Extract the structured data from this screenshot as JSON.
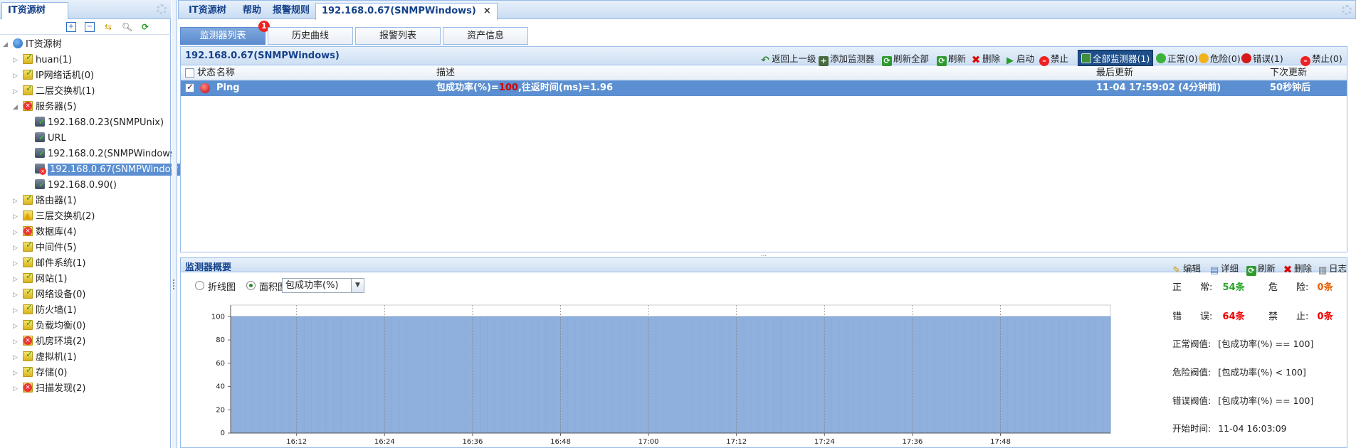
{
  "left_panel": {
    "tab_title": "IT资源树",
    "tree": {
      "root": "IT资源树",
      "items": [
        {
          "label": "huan(1)",
          "type": "folder-ok"
        },
        {
          "label": "IP网络话机(0)",
          "type": "folder-ok"
        },
        {
          "label": "二层交换机(1)",
          "type": "folder-ok"
        },
        {
          "label": "服务器(5)",
          "type": "folder-err",
          "expanded": true,
          "children": [
            {
              "label": "192.168.0.23(SNMPUnix)",
              "type": "server-ok"
            },
            {
              "label": "URL",
              "type": "server-ok"
            },
            {
              "label": "192.168.0.2(SNMPWindows",
              "type": "server-ok"
            },
            {
              "label": "192.168.0.67(SNMPWindow",
              "type": "server-err",
              "selected": true
            },
            {
              "label": "192.168.0.90()",
              "type": "server-ok"
            }
          ]
        },
        {
          "label": "路由器(1)",
          "type": "folder-ok"
        },
        {
          "label": "三层交换机(2)",
          "type": "folder-warn"
        },
        {
          "label": "数据库(4)",
          "type": "folder-err"
        },
        {
          "label": "中间件(5)",
          "type": "folder-ok"
        },
        {
          "label": "邮件系统(1)",
          "type": "folder-ok"
        },
        {
          "label": "网站(1)",
          "type": "folder-ok"
        },
        {
          "label": "网络设备(0)",
          "type": "folder-ok"
        },
        {
          "label": "防火墙(1)",
          "type": "folder-ok"
        },
        {
          "label": "负载均衡(0)",
          "type": "folder-ok"
        },
        {
          "label": "机房环境(2)",
          "type": "folder-err"
        },
        {
          "label": "虚拟机(1)",
          "type": "folder-ok"
        },
        {
          "label": "存储(0)",
          "type": "folder-ok"
        },
        {
          "label": "扫描发现(2)",
          "type": "folder-err"
        }
      ]
    }
  },
  "main_tabs": [
    {
      "label": "IT资源树"
    },
    {
      "label": "帮助"
    },
    {
      "label": "报警规则"
    },
    {
      "label": "192.168.0.67(SNMPWindows)",
      "active": true,
      "close": "×"
    }
  ],
  "sub_tabs": [
    {
      "label": "监测器列表",
      "active": true,
      "badge": "1"
    },
    {
      "label": "历史曲线"
    },
    {
      "label": "报警列表"
    },
    {
      "label": "资产信息"
    }
  ],
  "grid_panel": {
    "title": "192.168.0.67(SNMPWindows)",
    "toolbar": {
      "back": "返回上一级",
      "add_monitor": "添加监测器",
      "refresh_all": "刷新全部",
      "refresh": "刷新",
      "delete": "删除",
      "start": "启动",
      "disable": "禁止",
      "all_monitors": "全部监测器(1)",
      "normal": "正常(0)",
      "danger": "危险(0)",
      "error": "错误(1)",
      "forbidden": "禁止(0)"
    },
    "columns": {
      "status": "状态",
      "name": "名称",
      "desc": "描述",
      "last_update": "最后更新",
      "next_update": "下次更新"
    },
    "row": {
      "name": "Ping",
      "desc_pre": "包成功率(%)=",
      "desc_val": "100",
      "desc_post": ",往返时间(ms)=1.96",
      "last_update": "11-04 17:59:02 (4分钟前)",
      "next_update": "50秒钟后"
    }
  },
  "splitter_glyph": "...",
  "detail_panel": {
    "title": "监测器概要",
    "toolbar": {
      "edit": "编辑",
      "detail": "详细",
      "refresh": "刷新",
      "delete": "删除",
      "log": "日志"
    },
    "radio_line": "折线图",
    "radio_area": "面积图",
    "combo_value": "包成功率(%)",
    "stats": {
      "normal_label": "正　　常:",
      "normal_value": "54条",
      "danger_label": "危　　险:",
      "danger_value": "0条",
      "error_label": "错　　误:",
      "error_value": "64条",
      "forbid_label": "禁　　止:",
      "forbid_value": "0条",
      "normal_threshold_label": "正常阀值:",
      "normal_threshold": "[包成功率(%) == 100]",
      "danger_threshold_label": "危险阀值:",
      "danger_threshold": "[包成功率(%) < 100]",
      "error_threshold_label": "错误阀值:",
      "error_threshold": "[包成功率(%) == 100]",
      "start_time_label": "开始时间:",
      "start_time": "11-04 16:03:09"
    }
  },
  "colors": {
    "accent": "#5b8fd1",
    "header_text": "#15428b",
    "area_fill": "#8fb0dc",
    "error": "#e00000"
  },
  "chart_data": {
    "type": "area",
    "x": [
      "16:12",
      "16:24",
      "16:36",
      "16:48",
      "17:00",
      "17:12",
      "17:24",
      "17:36",
      "17:48"
    ],
    "series": [
      {
        "values": [
          100,
          100,
          100,
          100,
          100,
          100,
          100,
          100,
          100
        ]
      }
    ],
    "x_range": [
      "16:03",
      "18:03"
    ],
    "yticks": [
      "100",
      "80",
      "60",
      "40",
      "20",
      "0"
    ],
    "ylim": [
      0,
      110
    ],
    "grid": true
  }
}
